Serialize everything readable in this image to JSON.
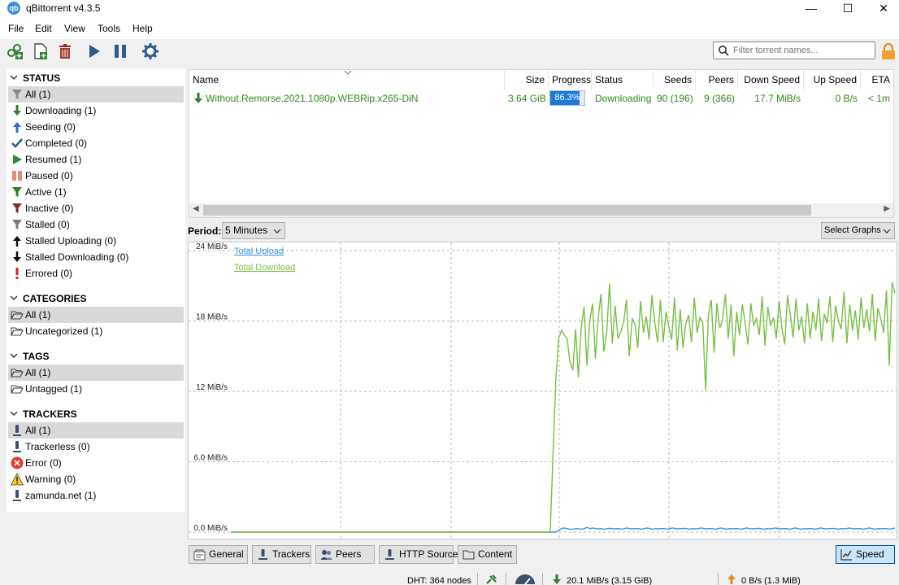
{
  "window": {
    "title": "qBittorrent v4.3.5",
    "app_icon_text": "qb"
  },
  "menu": [
    "File",
    "Edit",
    "View",
    "Tools",
    "Help"
  ],
  "search": {
    "placeholder": "Filter torrent names..."
  },
  "sidebar": {
    "status": {
      "heading": "STATUS",
      "items": [
        {
          "label": "All (1)",
          "icon": "filter-icon",
          "selected": true
        },
        {
          "label": "Downloading (1)",
          "icon": "download-arrow-icon"
        },
        {
          "label": "Seeding (0)",
          "icon": "upload-arrow-icon"
        },
        {
          "label": "Completed (0)",
          "icon": "checkmark-icon"
        },
        {
          "label": "Resumed (1)",
          "icon": "play-icon"
        },
        {
          "label": "Paused (0)",
          "icon": "pause-icon"
        },
        {
          "label": "Active (1)",
          "icon": "filter-active-icon"
        },
        {
          "label": "Inactive (0)",
          "icon": "filter-inactive-icon"
        },
        {
          "label": "Stalled (0)",
          "icon": "filter-stalled-icon"
        },
        {
          "label": "Stalled Uploading (0)",
          "icon": "stalled-upload-icon"
        },
        {
          "label": "Stalled Downloading (0)",
          "icon": "stalled-download-icon"
        },
        {
          "label": "Errored (0)",
          "icon": "error-exclamation-icon"
        }
      ]
    },
    "categories": {
      "heading": "CATEGORIES",
      "items": [
        {
          "label": "All (1)",
          "icon": "folder-open-icon",
          "selected": true
        },
        {
          "label": "Uncategorized (1)",
          "icon": "folder-open-icon"
        }
      ]
    },
    "tags": {
      "heading": "TAGS",
      "items": [
        {
          "label": "All (1)",
          "icon": "folder-open-icon",
          "selected": true
        },
        {
          "label": "Untagged (1)",
          "icon": "folder-open-icon"
        }
      ]
    },
    "trackers": {
      "heading": "TRACKERS",
      "items": [
        {
          "label": "All (1)",
          "icon": "tracker-icon",
          "selected": true
        },
        {
          "label": "Trackerless (0)",
          "icon": "tracker-icon"
        },
        {
          "label": "Error (0)",
          "icon": "error-icon"
        },
        {
          "label": "Warning (0)",
          "icon": "warning-icon"
        },
        {
          "label": "zamunda.net (1)",
          "icon": "tracker-icon"
        }
      ]
    }
  },
  "table": {
    "columns": [
      "Name",
      "Size",
      "Progress",
      "Status",
      "Seeds",
      "Peers",
      "Down Speed",
      "Up Speed",
      "ETA"
    ],
    "rows": [
      {
        "name": "Without.Remorse.2021.1080p.WEBRip.x265-DiN",
        "size": "3.64 GiB",
        "progress": "86.3%",
        "progress_value": 0.863,
        "status": "Downloading",
        "seeds": "90 (196)",
        "peers": "9 (366)",
        "down_speed": "17.7 MiB/s",
        "up_speed": "0 B/s",
        "eta": "< 1m"
      }
    ],
    "row_text_color": "#2d8a16"
  },
  "period": {
    "label": "Period:",
    "selected": "5 Minutes"
  },
  "select_graphs": "Select Graphs",
  "chart_data": {
    "type": "line",
    "title": "",
    "xlabel": "",
    "ylabel": "",
    "y_ticks": [
      "24 MiB/s",
      "18 MiB/s",
      "12 MiB/s",
      "6.0 MiB/s",
      "0.0 MiB/s"
    ],
    "ylim": [
      0,
      24
    ],
    "grid": true,
    "legend_position": "top-left",
    "series": [
      {
        "name": "Total Upload",
        "color": "#3a96dd",
        "values": [
          0,
          0,
          0,
          0,
          0,
          0,
          0,
          0,
          0,
          0,
          0,
          0,
          0,
          0,
          0,
          0,
          0,
          0,
          0,
          0,
          0,
          0,
          0,
          0,
          0,
          0,
          0,
          0,
          0,
          0,
          0,
          0,
          0,
          0,
          0,
          0,
          0,
          0,
          0,
          0,
          0,
          0,
          0,
          0,
          0,
          0,
          0,
          0,
          0,
          0,
          0,
          0,
          0,
          0,
          0,
          0,
          0,
          0,
          0,
          0,
          0,
          0,
          0,
          0,
          0,
          0,
          0,
          0,
          0,
          0,
          0,
          0,
          0,
          0,
          0,
          0,
          0,
          0,
          0,
          0,
          0,
          0,
          0,
          0,
          0,
          0,
          0,
          0,
          0,
          0,
          0,
          0,
          0,
          0,
          0,
          0,
          0,
          0,
          0,
          0,
          0,
          0,
          0,
          0,
          0,
          0,
          0,
          0,
          0,
          0,
          0,
          0,
          0,
          0,
          0,
          0.15,
          0.3,
          0.35,
          0.3,
          0.25,
          0.25,
          0.3,
          0.28,
          0.25,
          0.3,
          0.4,
          0.3,
          0.35,
          0.3,
          0.28,
          0.3,
          0.25,
          0.3,
          0.32,
          0.3,
          0.28,
          0.3,
          0.25,
          0.3,
          0.35,
          0.3,
          0.28,
          0.3,
          0.3,
          0.25,
          0.3,
          0.35,
          0.3,
          0.25,
          0.3,
          0.28,
          0.3,
          0.3,
          0.25,
          0.3,
          0.35,
          0.3,
          0.28,
          0.3,
          0.32,
          0.3,
          0.25,
          0.3,
          0.28,
          0.3,
          0.35,
          0.3,
          0.28,
          0.3,
          0.3,
          0.25,
          0.3,
          0.35,
          0.3,
          0.25,
          0.3,
          0.28,
          0.3,
          0.3,
          0.25,
          0.3,
          0.35,
          0.3,
          0.28,
          0.3,
          0.32,
          0.3,
          0.25,
          0.3,
          0.28,
          0.3,
          0.35,
          0.3,
          0.28,
          0.3,
          0.3,
          0.25,
          0.3,
          0.35,
          0.3,
          0.25,
          0.3,
          0.28,
          0.3,
          0.3,
          0.25,
          0.3,
          0.35,
          0.3,
          0.28,
          0.3,
          0.32,
          0.3,
          0.25,
          0.3,
          0.28,
          0.3,
          0.35,
          0.3,
          0.28,
          0.3,
          0.3,
          0.25,
          0.3,
          0.35,
          0.3,
          0.25,
          0.3,
          0.28,
          0.3,
          0.3,
          0.25,
          0.3,
          0.35
        ]
      },
      {
        "name": "Total Download",
        "color": "#76c043",
        "values": [
          0,
          0,
          0,
          0,
          0,
          0,
          0,
          0,
          0,
          0,
          0,
          0,
          0,
          0,
          0,
          0,
          0,
          0,
          0,
          0,
          0,
          0,
          0,
          0,
          0,
          0,
          0,
          0,
          0,
          0,
          0,
          0,
          0,
          0,
          0,
          0,
          0,
          0,
          0,
          0,
          0,
          0,
          0,
          0,
          0,
          0,
          0,
          0,
          0,
          0,
          0,
          0,
          0,
          0,
          0,
          0,
          0,
          0,
          0,
          0,
          0,
          0,
          0,
          0,
          0,
          0,
          0,
          0,
          0,
          0,
          0,
          0,
          0,
          0,
          0,
          0,
          0,
          0,
          0,
          0,
          0,
          0,
          0,
          0,
          0,
          0,
          0,
          0,
          0,
          0,
          0,
          0,
          0,
          0,
          0,
          0,
          0,
          0,
          0,
          0,
          0,
          0,
          0,
          0,
          0,
          0,
          0,
          0,
          0,
          0,
          0,
          0,
          0,
          0,
          6.5,
          13,
          16.5,
          17.2,
          16.8,
          16.5,
          14.5,
          13.8,
          17.3,
          13.2,
          17.5,
          19.2,
          14.2,
          18,
          19.5,
          14.8,
          18.3,
          20.3,
          15.4,
          17,
          21.2,
          16.1,
          19.3,
          16.5,
          17.1,
          17.9,
          19.8,
          15,
          18.2,
          17.7,
          15.7,
          19.7,
          17,
          18.4,
          16.4,
          20.2,
          17.9,
          16.2,
          19.8,
          16.2,
          18.8,
          17.5,
          16.4,
          20,
          15.5,
          19,
          15.7,
          17.8,
          18.5,
          16.2,
          20,
          17,
          18.3,
          17.9,
          12.1,
          18.5,
          19.8,
          15.3,
          19.5,
          17.4,
          18.1,
          20.3,
          16.5,
          19.4,
          15,
          18.8,
          16.8,
          19.4,
          17.8,
          16,
          19.5,
          17.6,
          18.2,
          16.8,
          20.1,
          15.9,
          19.2,
          17.6,
          18.3,
          16.5,
          19.7,
          17.4,
          16,
          20.2,
          18.5,
          16.6,
          19.9,
          17.2,
          18.4,
          16.1,
          19.5,
          16.5,
          18.8,
          17.2,
          19.9,
          16.3,
          18.6,
          17.8,
          20.1,
          16.2,
          19.3,
          18,
          17.3,
          20.5,
          16.1,
          19.4,
          17.2,
          18.9,
          16.4,
          20,
          17.4,
          19,
          17.1,
          20.3,
          16.3,
          19.1,
          18.2,
          17,
          20.6,
          14.2,
          21.3,
          20.4
        ]
      }
    ]
  },
  "bottom_tabs": [
    {
      "label": "General",
      "icon": "general-icon"
    },
    {
      "label": "Trackers",
      "icon": "tracker-icon"
    },
    {
      "label": "Peers",
      "icon": "peers-icon"
    },
    {
      "label": "HTTP Sources",
      "icon": "http-sources-icon"
    },
    {
      "label": "Content",
      "icon": "folder-icon"
    },
    {
      "label": "Speed",
      "icon": "speed-chart-icon"
    }
  ],
  "statusbar": {
    "dht": "DHT: 364 nodes",
    "download": "20.1 MiB/s (3.15 GiB)",
    "upload": "0 B/s (1.3 MiB)"
  }
}
